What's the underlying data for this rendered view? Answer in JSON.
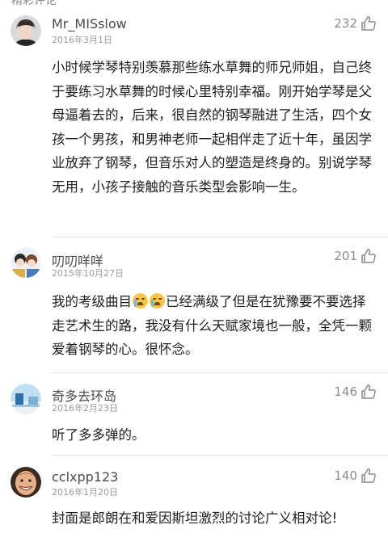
{
  "section": {
    "title": "精彩评论"
  },
  "comments": [
    {
      "username": "Mr_MISslow",
      "date": "2016年3月1日",
      "likes": "232",
      "text": "小时候学琴特别羡慕那些练水草舞的师兄师姐，自己终于要练习水草舞的时候心里特别幸福。刚开始学琴是父母逼着去的，后来，很自然的钢琴融进了生活，四个女孩一个男孩，和男神老师一起相伴走了近十年，虽因学业放弃了钢琴，但音乐对人的塑造是终身的。别说学琴无用，小孩子接触的音乐类型会影响一生。"
    },
    {
      "username": "叨叨咩咩",
      "date": "2015年10月27日",
      "likes": "201",
      "text_before": "我的考级曲目",
      "text_after": "已经满级了但是在犹豫要不要选择走艺术生的路，我没有什么天赋家境也一般，全凭一颗爱着钢琴的心。很怀念。",
      "emojis": [
        "crying-emoji",
        "crying-emoji"
      ]
    },
    {
      "username": "奇多去环岛",
      "date": "2016年2月23日",
      "likes": "146",
      "text": "听了多多弹的。"
    },
    {
      "username": "cclxpp123",
      "date": "2016年1月20日",
      "likes": "140",
      "text": "封面是郎朗在和爱因斯坦激烈的讨论广义相对论!"
    }
  ],
  "icons": {
    "like": "thumbs-up-outline-icon"
  },
  "colors": {
    "username": "#4a4a4a",
    "meta": "#9a9a9a",
    "divider": "#e4e4e4"
  }
}
